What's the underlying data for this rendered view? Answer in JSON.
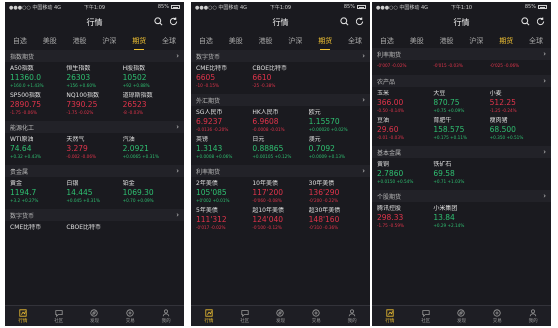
{
  "phones": [
    {
      "status": {
        "carrier": "●●●○○ 中国移动  4G",
        "time": "下午1:09",
        "battery": "85%"
      },
      "title": "行情",
      "tabs": [
        "自选",
        "美股",
        "港股",
        "沪深",
        "期货",
        "全球"
      ],
      "active_tab": "期货",
      "sections": [
        {
          "title": "指数期货",
          "items": [
            {
              "name": "A50指数",
              "price": "11360.0",
              "chg": "+160.0 +1.43%",
              "dir": "up"
            },
            {
              "name": "恒生指数",
              "price": "26303",
              "chg": "+156 +0.60%",
              "dir": "up"
            },
            {
              "name": "H股指数",
              "price": "10502",
              "chg": "+92 +0.88%",
              "dir": "up"
            },
            {
              "name": "SP500指数",
              "price": "2890.75",
              "chg": "-1.75 -0.06%",
              "dir": "dn"
            },
            {
              "name": "NQ100指数",
              "price": "7390.25",
              "chg": "-1.75 -0.02%",
              "dir": "dn"
            },
            {
              "name": "道琼斯指数",
              "price": "26523",
              "chg": "-8 -0.03%",
              "dir": "dn"
            }
          ]
        },
        {
          "title": "能源化工",
          "items": [
            {
              "name": "WTI原油",
              "price": "74.64",
              "chg": "+0.32 +0.43%",
              "dir": "up"
            },
            {
              "name": "天然气",
              "price": "3.279",
              "chg": "-0.002 -0.06%",
              "dir": "dn"
            },
            {
              "name": "汽油",
              "price": "2.0921",
              "chg": "+0.0065 +0.31%",
              "dir": "up"
            }
          ]
        },
        {
          "title": "贵金属",
          "items": [
            {
              "name": "黄金",
              "price": "1194.7",
              "chg": "+3.2 +0.27%",
              "dir": "up"
            },
            {
              "name": "白银",
              "price": "14.445",
              "chg": "+0.045 +0.31%",
              "dir": "up"
            },
            {
              "name": "铂金",
              "price": "1069.30",
              "chg": "+0.70 +0.09%",
              "dir": "up"
            }
          ]
        },
        {
          "title": "数字货币",
          "items": [
            {
              "name": "CME比特币",
              "price": "",
              "chg": "",
              "dir": "up"
            },
            {
              "name": "CBOE比特币",
              "price": "",
              "chg": "",
              "dir": "up"
            }
          ]
        }
      ]
    },
    {
      "status": {
        "carrier": "●●●○○ 中国移动  4G",
        "time": "下午1:09",
        "battery": "85%"
      },
      "title": "行情",
      "tabs": [
        "自选",
        "美股",
        "港股",
        "沪深",
        "期货",
        "全球"
      ],
      "active_tab": "期货",
      "sections": [
        {
          "title": "数字货币",
          "items": [
            {
              "name": "CME比特币",
              "price": "6605",
              "chg": "-10 -0.15%",
              "dir": "dn"
            },
            {
              "name": "CBOE比特币",
              "price": "6610",
              "chg": "-25 -0.38%",
              "dir": "dn"
            }
          ]
        },
        {
          "title": "外汇期货",
          "items": [
            {
              "name": "SG人民币",
              "price": "6.9237",
              "chg": "-0.0136 -0.20%",
              "dir": "dn"
            },
            {
              "name": "HK人民币",
              "price": "6.9608",
              "chg": "-0.0008 -0.01%",
              "dir": "dn"
            },
            {
              "name": "欧元",
              "price": "1.15570",
              "chg": "+0.00020 +0.02%",
              "dir": "up"
            },
            {
              "name": "英镑",
              "price": "1.3143",
              "chg": "+0.0008 +0.06%",
              "dir": "up"
            },
            {
              "name": "日元",
              "price": "0.88865",
              "chg": "+0.00105 +0.12%",
              "dir": "up"
            },
            {
              "name": "澳元",
              "price": "0.7092",
              "chg": "+0.0009 +0.13%",
              "dir": "up"
            }
          ]
        },
        {
          "title": "利率期货",
          "items": [
            {
              "name": "2年美债",
              "price": "105'085",
              "chg": "+0'002 +0.01%",
              "dir": "up"
            },
            {
              "name": "10年美债",
              "price": "117'200",
              "chg": "-0'060 -0.08%",
              "dir": "dn"
            },
            {
              "name": "30年美债",
              "price": "136'290",
              "chg": "-0'200 -0.22%",
              "dir": "dn"
            },
            {
              "name": "5年美债",
              "price": "111'312",
              "chg": "-0'017 -0.02%",
              "dir": "dn"
            },
            {
              "name": "超10年美债",
              "price": "124'040",
              "chg": "-0'100 -0.12%",
              "dir": "dn"
            },
            {
              "name": "超30年美债",
              "price": "148'160",
              "chg": "-0'310 -0.36%",
              "dir": "dn"
            }
          ]
        }
      ]
    },
    {
      "status": {
        "carrier": "●●●○○ 中国移动  4G",
        "time": "下午1:10",
        "battery": "85%"
      },
      "title": "行情",
      "tabs": [
        "自选",
        "美股",
        "港股",
        "沪深",
        "期货",
        "全球"
      ],
      "active_tab": "期货",
      "sections": [
        {
          "title": "利率期货",
          "items": [
            {
              "name": "",
              "price": "",
              "chg": "-0'007 -0.02%",
              "dir": "dn"
            },
            {
              "name": "",
              "price": "",
              "chg": "-0'015 -0.03%",
              "dir": "dn"
            },
            {
              "name": "",
              "price": "",
              "chg": "-0'025 -0.06%",
              "dir": "dn"
            }
          ]
        },
        {
          "title": "农产品",
          "items": [
            {
              "name": "玉米",
              "price": "366.00",
              "chg": "-0.50 -0.14%",
              "dir": "dn"
            },
            {
              "name": "大豆",
              "price": "870.75",
              "chg": "+0.75 +0.09%",
              "dir": "up"
            },
            {
              "name": "小麦",
              "price": "512.25",
              "chg": "-1.25 -0.24%",
              "dir": "dn"
            },
            {
              "name": "豆油",
              "price": "29.60",
              "chg": "-0.01 -0.03%",
              "dir": "dn"
            },
            {
              "name": "育肥牛",
              "price": "158.575",
              "chg": "+0.175 +0.11%",
              "dir": "up"
            },
            {
              "name": "瘦肉猪",
              "price": "68.500",
              "chg": "+0.350 +0.51%",
              "dir": "up"
            }
          ]
        },
        {
          "title": "基本金属",
          "items": [
            {
              "name": "黄铜",
              "price": "2.7860",
              "chg": "+0.0150 +0.54%",
              "dir": "up"
            },
            {
              "name": "铁矿石",
              "price": "69.58",
              "chg": "+0.71 +1.03%",
              "dir": "up"
            }
          ]
        },
        {
          "title": "个股期货",
          "items": [
            {
              "name": "腾讯控股",
              "price": "298.33",
              "chg": "-1.75 -0.59%",
              "dir": "dn"
            },
            {
              "name": "小米集团",
              "price": "13.84",
              "chg": "+0.29 +2.14%",
              "dir": "up"
            }
          ]
        }
      ]
    }
  ],
  "bottom_nav": [
    {
      "label": "行情",
      "icon": "chart-icon"
    },
    {
      "label": "社区",
      "icon": "community-icon"
    },
    {
      "label": "发现",
      "icon": "compass-icon"
    },
    {
      "label": "交易",
      "icon": "trade-icon"
    },
    {
      "label": "我的",
      "icon": "profile-icon"
    }
  ],
  "colors": {
    "up": "#2fbf71",
    "down": "#e0344b",
    "accent": "#f1c232",
    "background": "#1a1a1f"
  }
}
